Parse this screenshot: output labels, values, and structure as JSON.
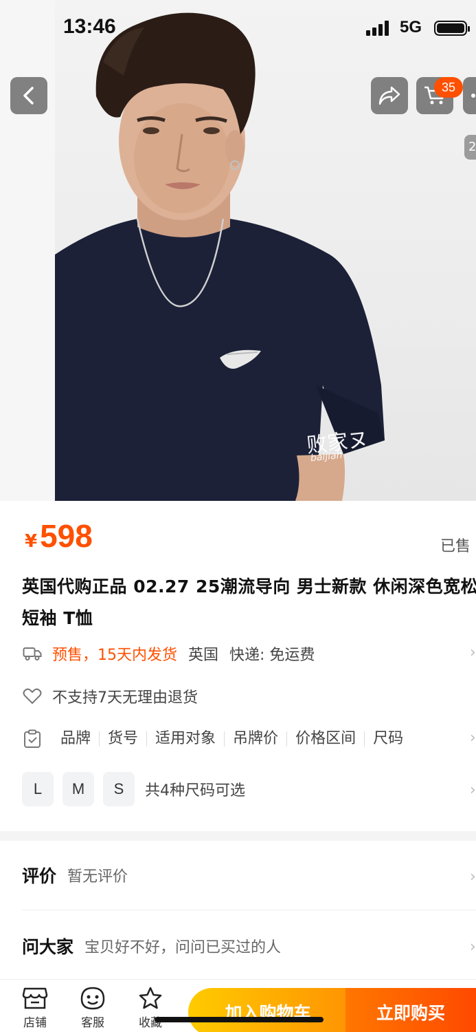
{
  "status_bar": {
    "time": "13:46",
    "network": "5G"
  },
  "top_nav": {
    "cart_count": "35",
    "image_counter": "2"
  },
  "watermark": {
    "text": "败家ヌ",
    "sub": "baijiah"
  },
  "product": {
    "currency": "¥",
    "price": "598",
    "sold_label": "已售",
    "title": "英国代购正品 02.27 25潮流导向 男士新款 休闲深色宽松短袖 T恤"
  },
  "shipping": {
    "presale": "预售，15天内发货",
    "origin": "英国",
    "delivery": "快递: 免运费"
  },
  "returns": {
    "text": "不支持7天无理由退货"
  },
  "params": [
    "品牌",
    "货号",
    "适用对象",
    "吊牌价",
    "价格区间",
    "尺码"
  ],
  "sizes": {
    "options": [
      "L",
      "M",
      "S"
    ],
    "count_text": "共4种尺码可选"
  },
  "reviews": {
    "title": "评价",
    "sub": "暂无评价"
  },
  "ask": {
    "title": "问大家",
    "sub": "宝贝好不好，问问已买过的人"
  },
  "bottom_bar": {
    "store": "店铺",
    "service": "客服",
    "favorite": "收藏",
    "add_to_cart": "加入购物车",
    "buy_now": "立即购买"
  },
  "colors": {
    "accent": "#ff5000",
    "cart_button": "#ff9402",
    "buy_button": "#ff4900"
  }
}
